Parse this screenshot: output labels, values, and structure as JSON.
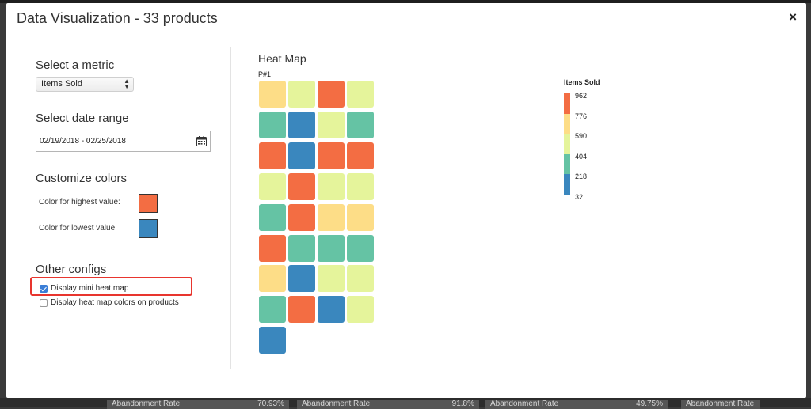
{
  "modal": {
    "title": "Data Visualization - 33 products",
    "close_symbol": "×"
  },
  "left": {
    "metric_title": "Select a metric",
    "metric_value": "Items Sold",
    "date_title": "Select date range",
    "date_value": "02/19/2018 - 02/25/2018",
    "colors_title": "Customize colors",
    "highest_label": "Color for highest value:",
    "highest_color": "#f36d43",
    "lowest_label": "Color for lowest value:",
    "lowest_color": "#3a87be",
    "other_title": "Other configs",
    "opt_mini": "Display mini heat map",
    "opt_mini_checked": true,
    "opt_colors": "Display heat map colors on products",
    "opt_colors_checked": false
  },
  "heatmap": {
    "title": "Heat Map",
    "subtitle": "P#1",
    "palette": [
      "#3a87be",
      "#65c3a4",
      "#e5f49b",
      "#fddd87",
      "#f36d43"
    ],
    "cells": [
      [
        3,
        2,
        4,
        2
      ],
      [
        1,
        0,
        2,
        1
      ],
      [
        4,
        0,
        4,
        4
      ],
      [
        2,
        4,
        2,
        2
      ],
      [
        1,
        4,
        3,
        3
      ],
      [
        4,
        1,
        1,
        1
      ],
      [
        3,
        0,
        2,
        2
      ],
      [
        1,
        4,
        0,
        2
      ],
      [
        0
      ]
    ]
  },
  "legend": {
    "title": "Items Sold",
    "ticks": [
      "962",
      "776",
      "590",
      "404",
      "218",
      "32"
    ]
  },
  "background": {
    "cells": [
      {
        "label": "Abandonment Rate",
        "value": "70.93%"
      },
      {
        "label": "Abandonment Rate",
        "value": "91.8%"
      },
      {
        "label": "Abandonment Rate",
        "value": "49.75%"
      },
      {
        "label": "Abandonment Rate",
        "value": ""
      }
    ]
  }
}
